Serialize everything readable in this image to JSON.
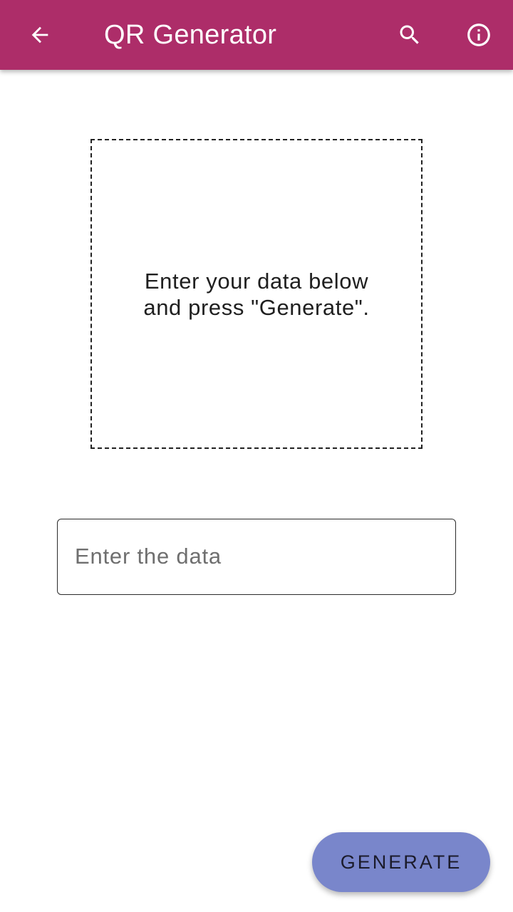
{
  "app_bar": {
    "title": "QR Generator",
    "background_color": "#ad2d69",
    "icons": {
      "back": "arrow-back-icon",
      "search": "search-icon",
      "info": "info-icon"
    }
  },
  "qr_area": {
    "placeholder_line1": "Enter your data below",
    "placeholder_line2": "and press \"Generate\"."
  },
  "data_input": {
    "value": "",
    "placeholder": "Enter the data"
  },
  "generate_button": {
    "label": "GENERATE",
    "background_color": "#7986cb"
  }
}
